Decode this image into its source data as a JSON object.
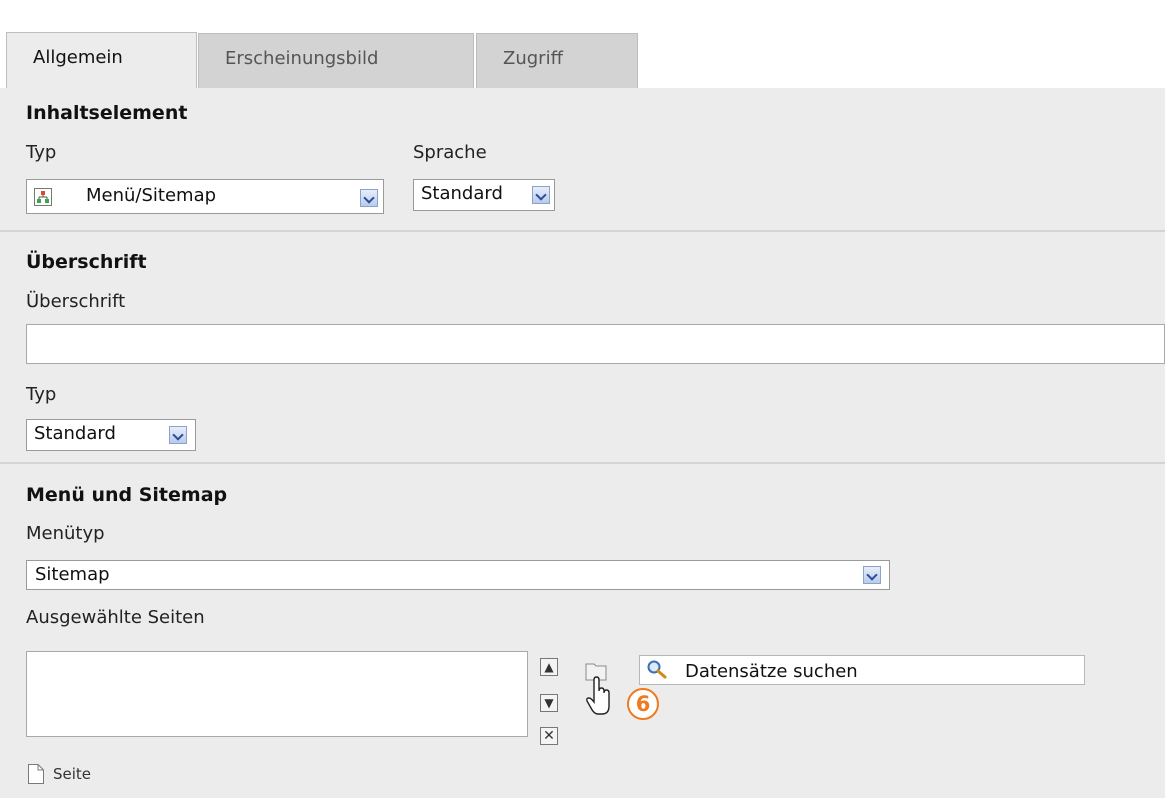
{
  "tabs": [
    {
      "label": "Allgemein"
    },
    {
      "label": "Erscheinungsbild"
    },
    {
      "label": "Zugriff"
    }
  ],
  "inhaltselement": {
    "title": "Inhaltselement",
    "typ_label": "Typ",
    "typ_value": "Menü/Sitemap",
    "sprache_label": "Sprache",
    "sprache_value": "Standard"
  },
  "ueberschrift": {
    "title": "Überschrift",
    "field_label": "Überschrift",
    "field_value": "",
    "typ_label": "Typ",
    "typ_value": "Standard"
  },
  "menue": {
    "title": "Menü und Sitemap",
    "menutyp_label": "Menütyp",
    "menutyp_value": "Sitemap",
    "pages_label": "Ausgewählte Seiten",
    "search_placeholder": "Datensätze suchen",
    "record_type_label": "Seite"
  },
  "annotation": {
    "step": "6"
  },
  "colors": {
    "panel": "#ececec",
    "tab_inactive": "#d3d3d3",
    "accent": "#f07a1e"
  }
}
